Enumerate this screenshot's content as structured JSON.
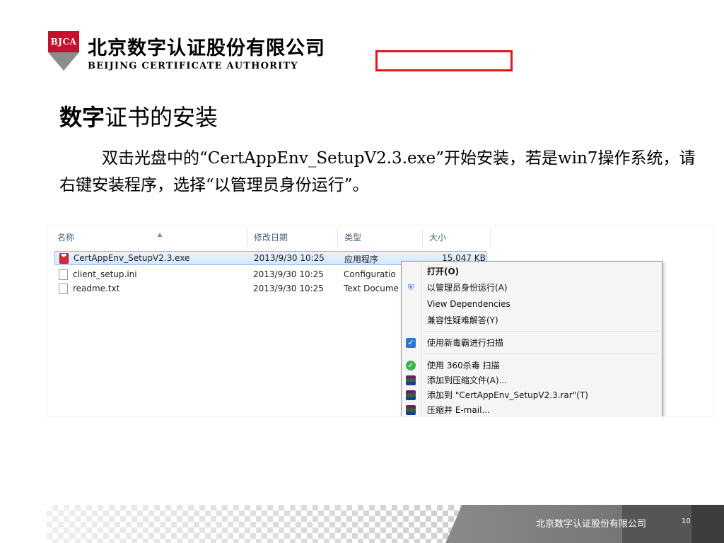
{
  "header": {
    "logo_text": "BJCA",
    "company_cn": "北京数字认证股份有限公司",
    "company_en": "BEIJING CERTIFICATE AUTHORITY",
    "brand_color": "#c8102e"
  },
  "slide": {
    "title_bold": "数字",
    "title_rest": "证书的安装",
    "paragraph": "双击光盘中的“CertAppEnv_SetupV2.3.exe”开始安装，若是win7操作系统，请右键安装程序，选择“以管理员身份运行”。"
  },
  "explorer": {
    "columns": [
      "名称",
      "修改日期",
      "类型",
      "大小"
    ],
    "sort_indicator": "▲",
    "files": [
      {
        "name": "CertAppEnv_SetupV2.3.exe",
        "date": "2013/9/30 10:25",
        "type": "应用程序",
        "size": "15,047 KB",
        "icon": "app-icon",
        "selected": true
      },
      {
        "name": "client_setup.ini",
        "date": "2013/9/30 10:25",
        "type": "Configuratio",
        "size": "",
        "icon": "document-icon",
        "selected": false
      },
      {
        "name": "readme.txt",
        "date": "2013/9/30 10:25",
        "type": "Text Docume",
        "size": "",
        "icon": "document-icon",
        "selected": false
      }
    ]
  },
  "context_menu": {
    "items": [
      {
        "label": "打开(O)",
        "icon": ""
      },
      {
        "label": "以管理员身份运行(A)",
        "icon": "shield-icon"
      },
      {
        "label": "View Dependencies",
        "icon": ""
      },
      {
        "label": "兼容性疑难解答(Y)",
        "icon": ""
      },
      {
        "label": "使用新毒霸进行扫描",
        "icon": "antivirus-check-icon"
      },
      {
        "label": "使用 360杀毒 扫描",
        "icon": "360-shield-icon"
      },
      {
        "label": "添加到压缩文件(A)...",
        "icon": "winrar-icon"
      },
      {
        "label": "添加到 \"CertAppEnv_SetupV2.3.rar\"(T)",
        "icon": "winrar-icon"
      },
      {
        "label": "压缩并 E-mail...",
        "icon": "winrar-icon"
      }
    ],
    "highlight_color": "#e3161e"
  },
  "footer": {
    "company": "北京数字认证股份有限公司",
    "page_number": "10"
  }
}
